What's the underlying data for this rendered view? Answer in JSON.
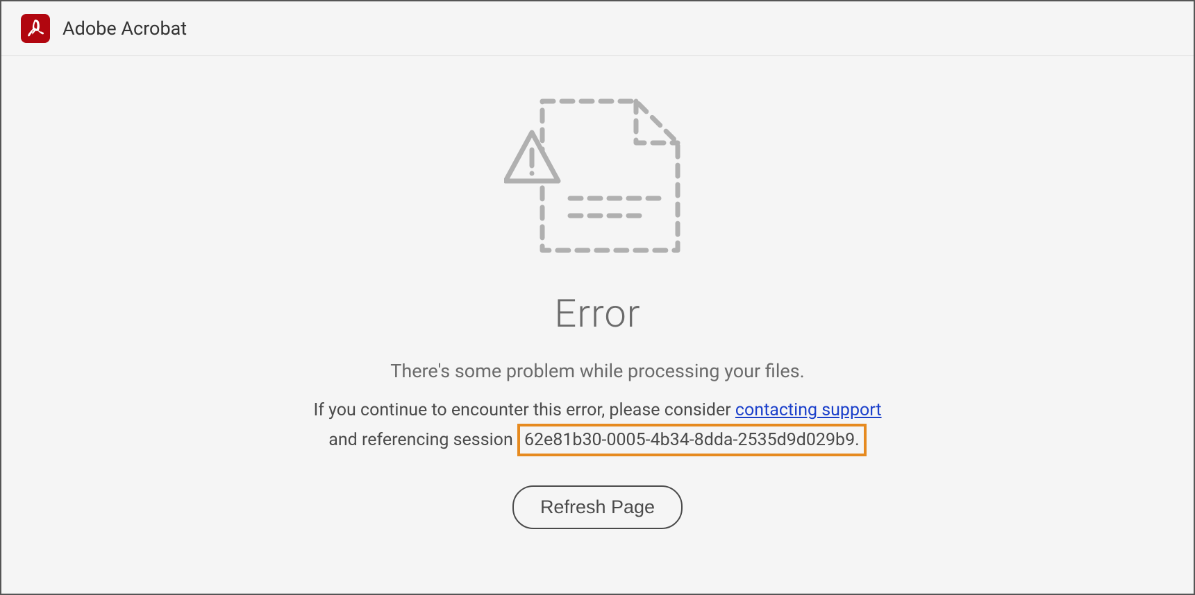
{
  "header": {
    "app_title": "Adobe Acrobat"
  },
  "error": {
    "heading": "Error",
    "subtitle": "There's some problem while processing your files.",
    "detail_before_link": "If you continue to encounter this error, please consider ",
    "support_link_text": "contacting support",
    "detail_after_link_before_session": " and referencing session ",
    "session_id": "62e81b30-0005-4b34-8dda-2535d9d029b9.",
    "refresh_button_label": "Refresh Page"
  }
}
